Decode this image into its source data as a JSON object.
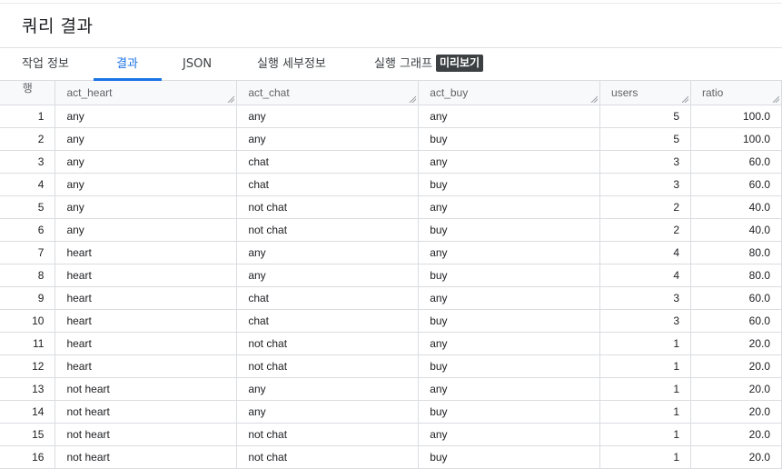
{
  "page": {
    "title": "쿼리 결과"
  },
  "tabs": [
    {
      "label": "작업 정보"
    },
    {
      "label": "결과"
    },
    {
      "label": "JSON"
    },
    {
      "label": "실행 세부정보"
    },
    {
      "label": "실행 그래프"
    }
  ],
  "preview_badge": "미리보기",
  "active_tab": "결과",
  "table": {
    "row_header": "행",
    "columns": [
      "act_heart",
      "act_chat",
      "act_buy",
      "users",
      "ratio"
    ],
    "rows": [
      [
        "1",
        "any",
        "any",
        "any",
        "5",
        "100.0"
      ],
      [
        "2",
        "any",
        "any",
        "buy",
        "5",
        "100.0"
      ],
      [
        "3",
        "any",
        "chat",
        "any",
        "3",
        "60.0"
      ],
      [
        "4",
        "any",
        "chat",
        "buy",
        "3",
        "60.0"
      ],
      [
        "5",
        "any",
        "not chat",
        "any",
        "2",
        "40.0"
      ],
      [
        "6",
        "any",
        "not chat",
        "buy",
        "2",
        "40.0"
      ],
      [
        "7",
        "heart",
        "any",
        "any",
        "4",
        "80.0"
      ],
      [
        "8",
        "heart",
        "any",
        "buy",
        "4",
        "80.0"
      ],
      [
        "9",
        "heart",
        "chat",
        "any",
        "3",
        "60.0"
      ],
      [
        "10",
        "heart",
        "chat",
        "buy",
        "3",
        "60.0"
      ],
      [
        "11",
        "heart",
        "not chat",
        "any",
        "1",
        "20.0"
      ],
      [
        "12",
        "heart",
        "not chat",
        "buy",
        "1",
        "20.0"
      ],
      [
        "13",
        "not heart",
        "any",
        "any",
        "1",
        "20.0"
      ],
      [
        "14",
        "not heart",
        "any",
        "buy",
        "1",
        "20.0"
      ],
      [
        "15",
        "not heart",
        "not chat",
        "any",
        "1",
        "20.0"
      ],
      [
        "16",
        "not heart",
        "not chat",
        "buy",
        "1",
        "20.0"
      ]
    ]
  },
  "colors": {
    "accent": "#1a73e8",
    "border": "#dadce0",
    "header_bg": "#f8f9fa",
    "badge_bg": "#3c4043"
  }
}
